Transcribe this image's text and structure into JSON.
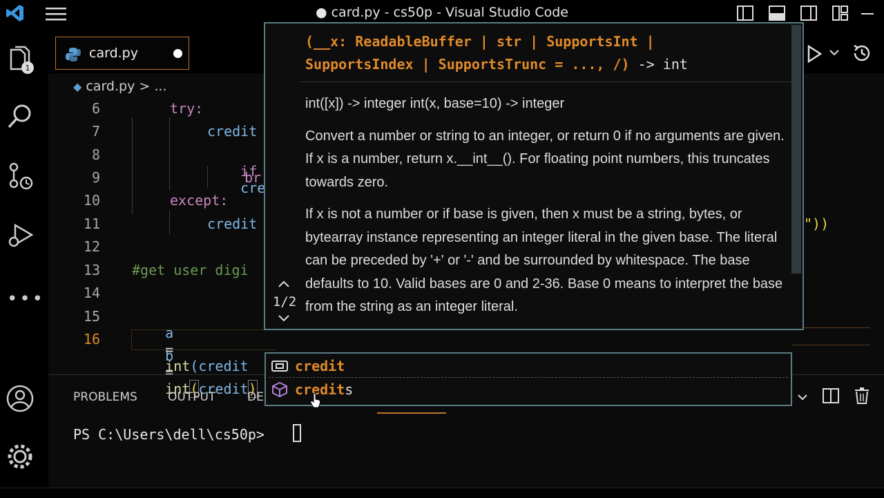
{
  "window": {
    "title": "● card.py - cs50p - Visual Studio Code"
  },
  "tabs": [
    {
      "label": "card.py",
      "modified": true
    }
  ],
  "breadcrumb": {
    "file": "card.py",
    "separator": ">",
    "rest": "..."
  },
  "editor": {
    "line_numbers": [
      "6",
      "7",
      "8",
      "9",
      "10",
      "11",
      "12",
      "13",
      "14",
      "15",
      "16"
    ],
    "active_line": "16",
    "lines": {
      "l6": "try:",
      "l7": "credit",
      "l8_kw": "if",
      "l8_rest": "cre",
      "l9": "br",
      "l10": "except:",
      "l11": "credit",
      "l11_tail": "\"))",
      "l13": "#get user digi",
      "l15_a": "a",
      "l15_eq": "=",
      "l15_fn": "int",
      "l15_arg": "(credit",
      "l16_b": "b",
      "l16_eq": "=",
      "l16_fn": "int",
      "l16_open": "(",
      "l16_arg": "credit",
      "l16_close": ")"
    }
  },
  "hover": {
    "signature_parts": [
      "(__x: ReadableBuffer | str | SupportsInt |",
      "SupportsIndex | SupportsTrunc = ..., /)",
      " -> int"
    ],
    "doc": [
      "int([x]) -> integer int(x, base=10) -> integer",
      "Convert a number or string to an integer, or return 0 if no arguments are given. If x is a number, return x.__int__(). For floating point numbers, this truncates towards zero.",
      "If x is not a number or if base is given, then x must be a string, bytes, or bytearray instance representing an integer literal in the given base. The literal can be preceded by '+' or '-' and be surrounded by whitespace. The base defaults to 10. Valid bases are 0 and 2-36. Base 0 means to interpret the base from the string as an integer literal."
    ],
    "counter": "1/2"
  },
  "suggest": {
    "items": [
      {
        "match": "credit",
        "rest": "",
        "icon": "variable-icon"
      },
      {
        "match": "credit",
        "rest": "s",
        "icon": "module-icon"
      }
    ]
  },
  "panel": {
    "tabs": [
      "PROBLEMS",
      "OUTPUT",
      "DE"
    ],
    "terminal_prompt": "PS C:\\Users\\dell\\cs50p>"
  },
  "colors": {
    "accent_orange": "#e08a2a",
    "widget_border": "#5b7c85",
    "keyword": "#c586c0",
    "variable": "#7fb7e6",
    "function": "#dcdcaa",
    "comment": "#6a9955"
  }
}
